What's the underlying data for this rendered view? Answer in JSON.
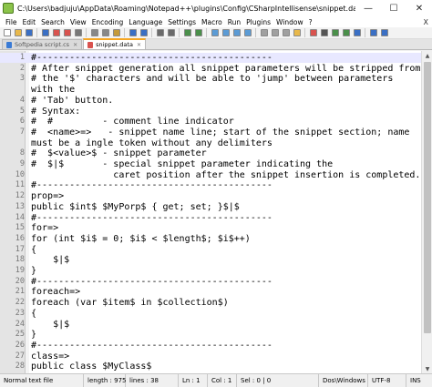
{
  "window": {
    "title": "C:\\Users\\badjuju\\AppData\\Roaming\\Notepad++\\plugins\\Config\\CSharpIntellisense\\snippet.data - Notepad++",
    "minimize": "—",
    "maximize": "☐",
    "close": "✕"
  },
  "menu": {
    "items": [
      "File",
      "Edit",
      "Search",
      "View",
      "Encoding",
      "Language",
      "Settings",
      "Macro",
      "Run",
      "Plugins",
      "Window",
      "?"
    ],
    "close_doc": "X"
  },
  "toolbar": {
    "icons": [
      {
        "name": "new-file-icon",
        "color": "#ffffff"
      },
      {
        "name": "open-file-icon",
        "color": "#e8b84a"
      },
      {
        "name": "save-icon",
        "color": "#3a6fc4"
      },
      {
        "name": "save-all-icon",
        "color": "#3a6fc4"
      },
      {
        "name": "close-file-icon",
        "color": "#d9534f"
      },
      {
        "name": "close-all-icon",
        "color": "#d9534f"
      },
      {
        "name": "print-icon",
        "color": "#777777"
      },
      {
        "name": "cut-icon",
        "color": "#888888"
      },
      {
        "name": "copy-icon",
        "color": "#888888"
      },
      {
        "name": "paste-icon",
        "color": "#c49a3a"
      },
      {
        "name": "undo-icon",
        "color": "#3a6fc4"
      },
      {
        "name": "redo-icon",
        "color": "#3a6fc4"
      },
      {
        "name": "find-icon",
        "color": "#6a6a6a"
      },
      {
        "name": "replace-icon",
        "color": "#6a6a6a"
      },
      {
        "name": "zoom-in-icon",
        "color": "#4a8f4a"
      },
      {
        "name": "zoom-out-icon",
        "color": "#4a8f4a"
      },
      {
        "name": "sync-scroll-icon",
        "color": "#5b9bd5"
      },
      {
        "name": "word-wrap-icon",
        "color": "#5b9bd5"
      },
      {
        "name": "show-all-chars-icon",
        "color": "#5b9bd5"
      },
      {
        "name": "indent-guide-icon",
        "color": "#5b9bd5"
      },
      {
        "name": "language-icon",
        "color": "#a0a0a0"
      },
      {
        "name": "doc-map-icon",
        "color": "#a0a0a0"
      },
      {
        "name": "function-list-icon",
        "color": "#a0a0a0"
      },
      {
        "name": "folder-workspace-icon",
        "color": "#e8b84a"
      },
      {
        "name": "record-macro-icon",
        "color": "#d9534f"
      },
      {
        "name": "stop-macro-icon",
        "color": "#555555"
      },
      {
        "name": "play-macro-icon",
        "color": "#4a8f4a"
      },
      {
        "name": "play-multiple-icon",
        "color": "#4a8f4a"
      },
      {
        "name": "save-macro-icon",
        "color": "#3a6fc4"
      },
      {
        "name": "spellcheck-icon",
        "color": "#3a6fc4"
      },
      {
        "name": "spellcheck-abc-icon",
        "color": "#3a6fc4"
      }
    ]
  },
  "tabs": [
    {
      "label": "Softpedia script.cs",
      "active": false
    },
    {
      "label": "snippet.data",
      "active": true
    }
  ],
  "editor": {
    "current_line": 1,
    "lines": [
      {
        "n": "1",
        "t": "#-------------------------------------------"
      },
      {
        "n": "2",
        "t": "# After snippet generation all snippet parameters will be stripped from"
      },
      {
        "n": "3",
        "t": "# the '$' characters and will be able to 'jump' between parameters"
      },
      {
        "n": "",
        "t": "with the"
      },
      {
        "n": "4",
        "t": "# 'Tab' button."
      },
      {
        "n": "5",
        "t": "# Syntax:"
      },
      {
        "n": "6",
        "t": "#  #         - comment line indicator"
      },
      {
        "n": "7",
        "t": "#  <name>=>   - snippet name line; start of the snippet section; name"
      },
      {
        "n": "",
        "t": "must be a ingle token without any delimiters"
      },
      {
        "n": "8",
        "t": "#  $<value>$ - snippet parameter"
      },
      {
        "n": "9",
        "t": "#  $|$       - special snippet parameter indicating the"
      },
      {
        "n": "10",
        "t": "               caret position after the snippet insertion is completed."
      },
      {
        "n": "11",
        "t": "#-------------------------------------------"
      },
      {
        "n": "12",
        "t": "prop=>"
      },
      {
        "n": "13",
        "t": "public $int$ $MyPorp$ { get; set; }$|$"
      },
      {
        "n": "14",
        "t": "#-------------------------------------------"
      },
      {
        "n": "15",
        "t": "for=>"
      },
      {
        "n": "16",
        "t": "for (int $i$ = 0; $i$ < $length$; $i$++)"
      },
      {
        "n": "17",
        "t": "{"
      },
      {
        "n": "18",
        "t": "    $|$"
      },
      {
        "n": "19",
        "t": "}"
      },
      {
        "n": "20",
        "t": "#-------------------------------------------"
      },
      {
        "n": "21",
        "t": "foreach=>"
      },
      {
        "n": "22",
        "t": "foreach (var $item$ in $collection$)"
      },
      {
        "n": "23",
        "t": "{"
      },
      {
        "n": "24",
        "t": "    $|$"
      },
      {
        "n": "25",
        "t": "}"
      },
      {
        "n": "26",
        "t": "#-------------------------------------------"
      },
      {
        "n": "27",
        "t": "class=>"
      },
      {
        "n": "28",
        "t": "public class $MyClass$"
      }
    ]
  },
  "status": {
    "type": "Normal text file",
    "length": "length : 975",
    "lines": "lines : 38",
    "ln": "Ln : 1",
    "col": "Col : 1",
    "sel": "Sel : 0 | 0",
    "eol": "Dos\\Windows",
    "encoding": "UTF-8",
    "mode": "INS"
  }
}
